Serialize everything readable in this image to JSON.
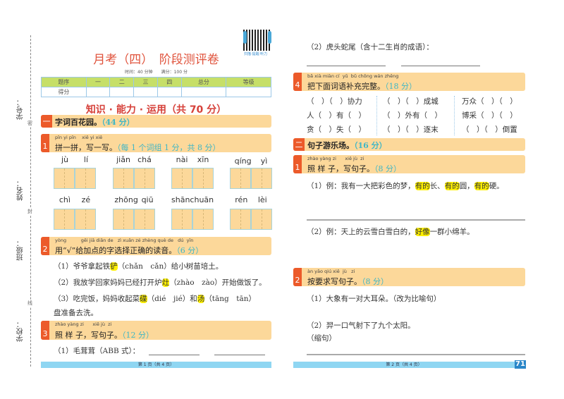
{
  "margin": {
    "labels": [
      "学号：",
      "姓名：",
      "班级：",
      "学校："
    ],
    "seal": [
      "密",
      "封",
      "线"
    ]
  },
  "qr_caption": "扫描·提醒·听力",
  "title": "月考（四）　阶段测评卷",
  "meta": "时间：40 分钟　　满分：100 分",
  "score_table": {
    "headers": [
      "题序",
      "一",
      "二",
      "三",
      "四",
      "总分",
      "等级"
    ],
    "row_label": "得分"
  },
  "banner": "知识 · 能力 · 运用（共 70 分）",
  "sec1": {
    "num": "一",
    "title": "字词百花园。",
    "points": "（44 分）"
  },
  "q1": {
    "num": "1",
    "pinyin": "pīn yi pīn    xiě yi xiě",
    "text": "拼一拼，写一写。",
    "points": "（每 1 个词组 1 分，共 8 分）",
    "row1": [
      [
        "jù",
        "lí"
      ],
      [
        "jiǎn",
        "chá"
      ],
      [
        "nài",
        "xīn"
      ],
      [
        "qíng",
        "yì"
      ]
    ],
    "row2": [
      [
        "chì",
        "zé"
      ],
      [
        "zhōng",
        "qiū"
      ],
      [
        "shān",
        "chuān"
      ],
      [
        "rén",
        "lèi"
      ]
    ]
  },
  "q2": {
    "num": "2",
    "pinyin": "yòng          gěi jiā diǎn de   zì xuǎn zé zhèng què de   dú  yīn",
    "text": "用“√”给加点的字选择正确的读音。",
    "points": "（6 分）",
    "items": [
      {
        "pre": "（1）爷爷拿起铁",
        "hl": "铲",
        "post": "（chǎn　cǎn）给小树苗培土。"
      },
      {
        "pre": "（2）我放学回家妈妈已经打开炉",
        "hl": "灶",
        "post": "（zhào　zào）开始做饭了。"
      },
      {
        "pre": "（3）吃完饭，妈妈收起菜",
        "hl": "碟",
        "mid": "（dié　jié）和",
        "hl2": "汤",
        "post": "（tāng　tān）"
      }
    ],
    "cont": "盘准备去洗。"
  },
  "q3": {
    "num": "3",
    "pinyin": "zhào yàng zi      xiě jù  zi",
    "text": "照 样 子，写句子。",
    "points": "（12 分）",
    "item1": "（1）毛茸茸（ABB 式）：",
    "item2": "（2）虎头蛇尾（含十二生肖的成语）："
  },
  "footer_left": "第 1 页（共 4 页）",
  "q4": {
    "num": "4",
    "pinyin": "bǎ xià miàn cí  yǔ  bǔ chōng wán zhěng",
    "text": "把下面词语补充完整。",
    "points": "（18 分）",
    "cols": [
      [
        "（　）（　）协力",
        "人（　）有（　）",
        "贪（　）失（　）"
      ],
      [
        "（　）（　）成城",
        "（　）外有（　）",
        "（　）（　）逐末"
      ],
      [
        "万众（　）（　）",
        "博采（　）（　）",
        "（　）（　）倒置"
      ]
    ]
  },
  "sec2": {
    "num": "二",
    "title": "句子游乐场。",
    "points": "（16 分）"
  },
  "s2q1": {
    "num": "1",
    "pinyin": "zhào yàng zi      xiě jù  zi",
    "text": "照 样 子，写句子。",
    "points": "（8 分）",
    "ex1": {
      "a": "（1）例：我有一大把彩色的梦，",
      "h": "有的",
      "b": "长、",
      "c": "圆，",
      "d": "硬。"
    },
    "ex2": {
      "a": "（2）例：天上的云雪白雪白的，",
      "h": "好像",
      "b": "一群小绵羊。"
    }
  },
  "s2q2": {
    "num": "2",
    "pinyin": "àn yāo qiú xiě  jù   zi",
    "text": "按要求写句子。",
    "points": "（8 分）",
    "item1": "（1）大象有一对大耳朵。（改为比喻句）",
    "item2": "（2）羿一口气射下了九个太阳。",
    "item2b": "（缩句）"
  },
  "footer_right": "第 2 页（共 4 页）",
  "page_number": "71"
}
